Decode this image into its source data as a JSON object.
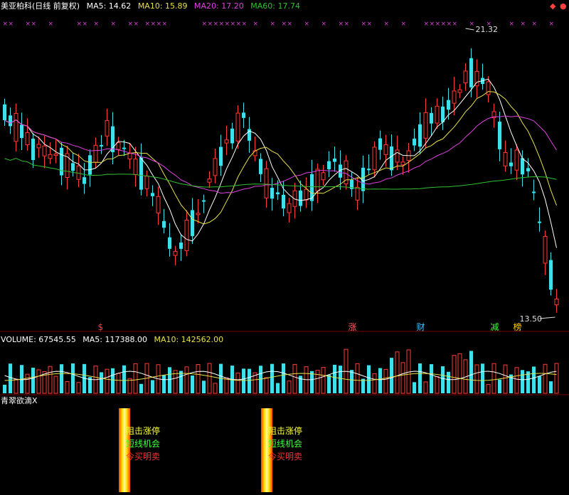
{
  "colors": {
    "up": "#ff3b3b",
    "down": "#3fe0e8",
    "ma5": "#ffffff",
    "ma10": "#e8e04a",
    "ma20": "#e040e0",
    "ma60": "#30c030",
    "grid": "#7a0000",
    "marker": "#d040d0"
  },
  "title": "美亚柏科(日线 前复权)",
  "ma_legend": [
    {
      "label": "MA5: 14.62",
      "color": "#ffffff"
    },
    {
      "label": "MA10: 15.89",
      "color": "#e8e04a"
    },
    {
      "label": "MA20: 17.20",
      "color": "#e040e0"
    },
    {
      "label": "MA60: 17.74",
      "color": "#30c030"
    }
  ],
  "price_high_label": "21.32",
  "price_low_label": "13.50",
  "event_tags": [
    {
      "text": "$",
      "color": "#ff3b3b",
      "index": 17
    },
    {
      "text": "涨",
      "color": "#ff6060",
      "index": 61
    },
    {
      "text": "财",
      "color": "#40c0ff",
      "index": 73
    },
    {
      "text": "减",
      "color": "#40ff40",
      "index": 86
    },
    {
      "text": "榜",
      "color": "#ffcc00",
      "index": 90
    }
  ],
  "volume_legend": [
    {
      "label": "VOLUME: 67545.55",
      "color": "#ffffff"
    },
    {
      "label": "MA5: 117388.00",
      "color": "#ffffff"
    },
    {
      "label": "MA10: 142562.00",
      "color": "#e8e04a"
    }
  ],
  "indicator_title": "青翠欲滴X",
  "signals": [
    {
      "index": 21,
      "lines": [
        {
          "text": "阻击涨停",
          "color": "#ffff40"
        },
        {
          "text": "短线机会",
          "color": "#40ff40"
        },
        {
          "text": "今买明卖",
          "color": "#ff3030"
        }
      ]
    },
    {
      "index": 46,
      "lines": [
        {
          "text": "阻击涨停",
          "color": "#ffff40"
        },
        {
          "text": "短线机会",
          "color": "#40ff40"
        },
        {
          "text": "今买明卖",
          "color": "#ff3030"
        }
      ]
    }
  ],
  "top_markers": [
    0,
    1,
    4,
    5,
    8,
    13,
    14,
    16,
    19,
    22,
    23,
    25,
    26,
    27,
    28,
    35,
    36,
    37,
    38,
    39,
    40,
    41,
    42,
    44,
    47,
    49,
    50,
    53,
    56,
    59,
    60,
    63,
    64,
    67,
    70,
    74,
    75,
    76,
    77,
    78,
    79,
    82,
    85,
    89,
    91,
    93,
    96
  ]
}
